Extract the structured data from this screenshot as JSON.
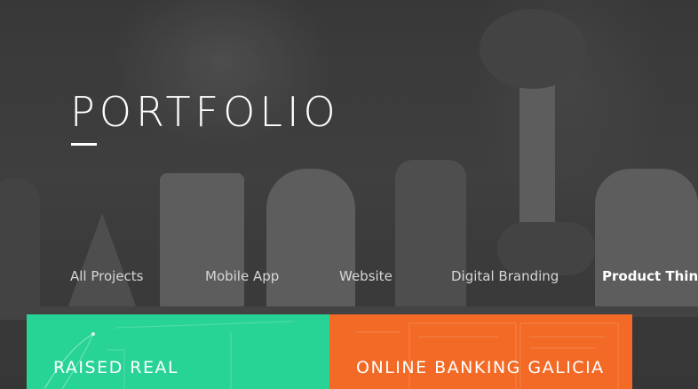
{
  "header": {
    "title": "PORTFOLIO"
  },
  "filters": [
    {
      "label": "All Projects",
      "active": false
    },
    {
      "label": "Mobile App",
      "active": false
    },
    {
      "label": "Website",
      "active": false
    },
    {
      "label": "Digital Branding",
      "active": false
    },
    {
      "label": "Product Think",
      "active": true
    }
  ],
  "cards": [
    {
      "title": "RAISED REAL",
      "color": "#28d495"
    },
    {
      "title": "ONLINE BANKING GALICIA",
      "color": "#f26a25"
    }
  ],
  "colors": {
    "text": "#ffffff",
    "inactive_filter": "#d6d6d6",
    "backdrop": "#3a3a3a"
  }
}
